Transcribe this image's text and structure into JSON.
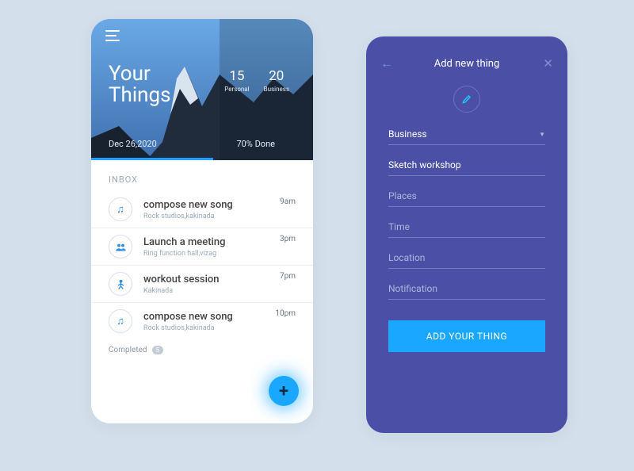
{
  "left": {
    "title_line1": "Your",
    "title_line2": "Things",
    "stats": [
      {
        "num": "15",
        "label": "Personal"
      },
      {
        "num": "20",
        "label": "Business"
      }
    ],
    "date": "Dec 26,2020",
    "progress_text": "70% Done",
    "inbox_label": "INBOX",
    "items": [
      {
        "icon": "music",
        "title": "compose new song",
        "sub": "Rock studios,kakinada",
        "time": "9am"
      },
      {
        "icon": "people",
        "title": "Launch a meeting",
        "sub": "Ring function hall,vizag",
        "time": "3pm"
      },
      {
        "icon": "person",
        "title": "workout  session",
        "sub": "Kakinada",
        "time": "7pm"
      },
      {
        "icon": "music",
        "title": "compose new song",
        "sub": "Rock studios,kakinada",
        "time": "10pm"
      }
    ],
    "completed_label": "Completed",
    "completed_count": "5"
  },
  "right": {
    "header": "Add new thing",
    "category_value": "Business",
    "task_value": "Sketch workshop",
    "placeholders": {
      "places": "Places",
      "time": "Time",
      "location": "Location",
      "notification": "Notification"
    },
    "button": "ADD YOUR THING"
  }
}
